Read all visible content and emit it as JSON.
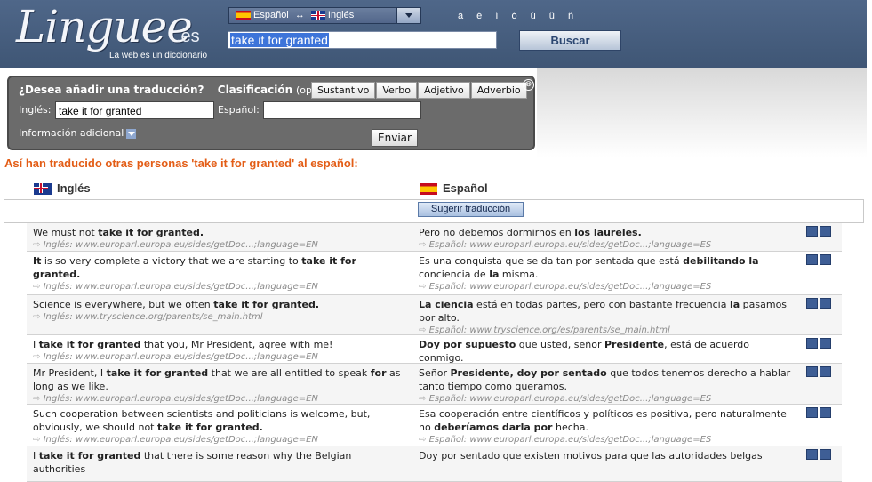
{
  "header": {
    "logo": "Linguee",
    "logo_domain": ".es",
    "tagline": "La web es un diccionario",
    "lang_from": "Español",
    "lang_arrows": "↔",
    "lang_to": "Inglés",
    "accents": "á é í ó ú ü ñ",
    "search_value": "take it for granted",
    "search_button": "Buscar"
  },
  "panel": {
    "question": "¿Desea añadir una traducción?",
    "classification": "Clasificación",
    "optional": "(opcional):",
    "classes": [
      "Sustantivo",
      "Verbo",
      "Adjetivo",
      "Adverbio"
    ],
    "close": "⊗",
    "label_en": "Inglés:",
    "input_en": "take it for granted",
    "label_es": "Español:",
    "input_es": "",
    "info": "Información adicional",
    "send": "Enviar"
  },
  "main": {
    "heading": "Así han traducido otras personas 'take it for granted' al español:",
    "col_en": "Inglés",
    "col_es": "Español",
    "suggest_button": "Sugerir traducción"
  },
  "results": [
    {
      "en": [
        [
          "We must not ",
          false
        ],
        [
          "take it for granted.",
          true
        ]
      ],
      "en_src": "Inglés: www.europarl.europa.eu/sides/getDoc...;language=EN",
      "es": [
        [
          "Pero no debemos dormirnos en ",
          false
        ],
        [
          "los laureles.",
          true
        ]
      ],
      "es_src": "Español: www.europarl.europa.eu/sides/getDoc...;language=ES"
    },
    {
      "en": [
        [
          "It",
          true
        ],
        [
          " is so very complete a victory that we are starting to ",
          false
        ],
        [
          "take it for granted.",
          true
        ]
      ],
      "en_src": "Inglés: www.europarl.europa.eu/sides/getDoc...;language=EN",
      "es": [
        [
          "Es una conquista que se da tan por sentada que está ",
          false
        ],
        [
          "debilitando la",
          true
        ],
        [
          " conciencia de ",
          false
        ],
        [
          "la",
          true
        ],
        [
          " misma.",
          false
        ]
      ],
      "es_src": "Español: www.europarl.europa.eu/sides/getDoc...;language=ES"
    },
    {
      "en": [
        [
          "Science is everywhere, but we often ",
          false
        ],
        [
          "take it for granted.",
          true
        ]
      ],
      "en_src": "Inglés: www.tryscience.org/parents/se_main.html",
      "es": [
        [
          "La ciencia",
          true
        ],
        [
          " está en todas partes, pero con bastante frecuencia ",
          false
        ],
        [
          "la",
          true
        ],
        [
          " pasamos por alto.",
          false
        ]
      ],
      "es_src": "Español: www.tryscience.org/es/parents/se_main.html"
    },
    {
      "en": [
        [
          "I ",
          false
        ],
        [
          "take it for granted",
          true
        ],
        [
          " that you, Mr President, agree with me!",
          false
        ]
      ],
      "en_src": "Inglés: www.europarl.europa.eu/sides/getDoc...;language=EN",
      "es": [
        [
          "Doy por supuesto",
          true
        ],
        [
          " que usted, señor ",
          false
        ],
        [
          "Presidente",
          true
        ],
        [
          ", está de acuerdo conmigo.",
          false
        ]
      ],
      "es_src": "Español: www.europarl.europa.eu/sides/getDoc...;language=ES"
    },
    {
      "en": [
        [
          "Mr President, I ",
          false
        ],
        [
          "take it for granted",
          true
        ],
        [
          " that we are all entitled to speak ",
          false
        ],
        [
          "for",
          true
        ],
        [
          " as long as we like.",
          false
        ]
      ],
      "en_src": "Inglés: www.europarl.europa.eu/sides/getDoc...;language=EN",
      "es": [
        [
          "Señor ",
          false
        ],
        [
          "Presidente, doy por sentado",
          true
        ],
        [
          " que todos tenemos derecho a hablar tanto tiempo como queramos.",
          false
        ]
      ],
      "es_src": "Español: www.europarl.europa.eu/sides/getDoc...;language=ES"
    },
    {
      "en": [
        [
          "Such cooperation between scientists and politicians is welcome, but, obviously, we should not ",
          false
        ],
        [
          "take it for granted.",
          true
        ]
      ],
      "en_src": "Inglés: www.europarl.europa.eu/sides/getDoc...;language=EN",
      "es": [
        [
          "Esa cooperación entre científicos y políticos es positiva, pero naturalmente no ",
          false
        ],
        [
          "deberíamos darla por",
          true
        ],
        [
          " hecha.",
          false
        ]
      ],
      "es_src": "Español: www.europarl.europa.eu/sides/getDoc...;language=ES"
    },
    {
      "en": [
        [
          "I ",
          false
        ],
        [
          "take it for granted",
          true
        ],
        [
          " that there is some reason why the Belgian authorities",
          false
        ]
      ],
      "en_src": "",
      "es": [
        [
          "Doy por sentado que existen motivos para que las autoridades belgas",
          false
        ]
      ],
      "es_src": ""
    }
  ],
  "colors": {
    "header_bg": "#4a6183",
    "heading_orange": "#e35d16",
    "panel_bg": "#6b6b6b"
  }
}
